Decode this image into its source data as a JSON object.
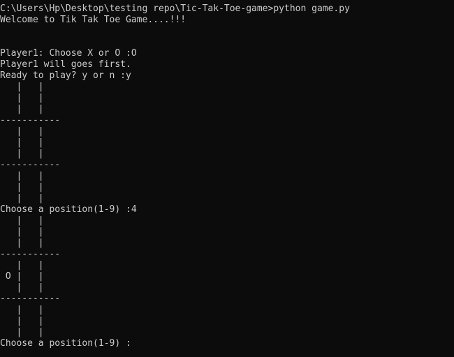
{
  "prompt": {
    "path": "C:\\Users\\Hp\\Desktop\\testing repo\\Tic-Tak-Toe-game>",
    "command": "python game.py"
  },
  "output": [
    "Welcome to Tik Tak Toe Game....!!!",
    "",
    "",
    "Player1: Choose X or O :O",
    "Player1 will goes first.",
    "Ready to play? y or n :y",
    "   |   |",
    "   |   |",
    "   |   |",
    "-----------",
    "   |   |",
    "   |   |",
    "   |   |",
    "-----------",
    "   |   |",
    "   |   |",
    "   |   |",
    "Choose a position(1-9) :4",
    "   |   |",
    "   |   |",
    "   |   |",
    "-----------",
    "   |   |",
    " O |   |",
    "   |   |",
    "-----------",
    "   |   |",
    "   |   |",
    "   |   |",
    "Choose a position(1-9) :"
  ]
}
